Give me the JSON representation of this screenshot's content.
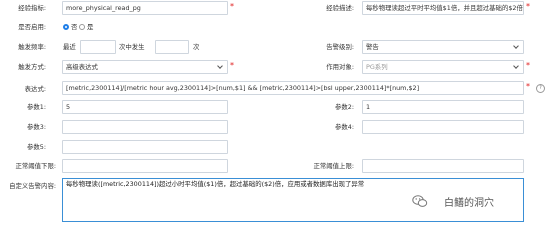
{
  "form": {
    "name_label": "经验指标:",
    "name_value": "more_physical_read_pg",
    "desc_label": "经验描述:",
    "desc_value": "每秒物理读超过平时平均值$1倍，并且超过基础的$2倍",
    "enabled_label": "是否启用:",
    "enabled_options": [
      "否",
      "是"
    ],
    "trigger_label": "触发频率:",
    "trigger_prefix": "最近",
    "trigger_mid": "次中发生",
    "trigger_suffix": "次",
    "alert_level_label": "告警级别:",
    "alert_level_value": "警告",
    "trigger_mode_label": "触发方式:",
    "trigger_mode_value": "高级表达式",
    "target_label": "作用对象:",
    "target_value": "PG系列",
    "expr_label": "表达式:",
    "expr_value": "[metric,2300114]/[metric hour avg,2300114]>[num,$1] && [metric,2300114]>[bsl upper,2300114]*[num,$2]",
    "p1_label": "参数1:",
    "p1_value": "5",
    "p2_label": "参数2:",
    "p2_value": "1",
    "p3_label": "参数3:",
    "p3_value": "",
    "p4_label": "参数4:",
    "p4_value": "",
    "p5_label": "参数5:",
    "p5_value": "",
    "low_label": "正常阈值下限:",
    "low_value": "",
    "high_label": "正常阈值上限:",
    "high_value": "",
    "custom_label": "自定义告警内容:",
    "custom_value": "每秒物理读([metric,2300114])超过小时平均值($1)倍，超过基础的($2)倍，应用或者数据库出现了异常",
    "help_glyph": "?"
  },
  "watermark": {
    "text": "白鳝的洞穴",
    "icon": "wechat-icon"
  },
  "colors": {
    "required": "#e02020",
    "accent": "#1e7ee8",
    "border": "#cfd6de",
    "focus": "#3a8fd6"
  }
}
